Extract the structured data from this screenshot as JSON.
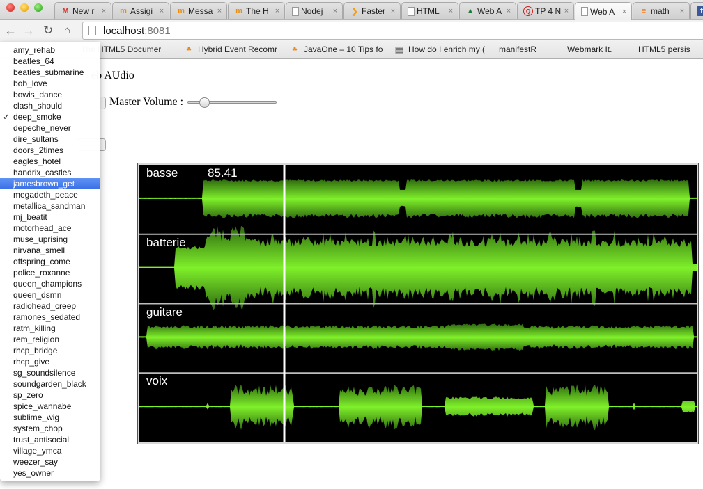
{
  "browser": {
    "tabs": [
      {
        "label": "New r",
        "icon": "gmail-icon",
        "active": false
      },
      {
        "label": "Assigi",
        "icon": "moodle-icon",
        "active": false
      },
      {
        "label": "Messa",
        "icon": "moodle-icon",
        "active": false
      },
      {
        "label": "The H",
        "icon": "moodle-icon",
        "active": false
      },
      {
        "label": "Nodej",
        "icon": "page-icon",
        "active": false
      },
      {
        "label": "Faster",
        "icon": "faster-icon",
        "active": false
      },
      {
        "label": "HTML",
        "icon": "page-icon",
        "active": false
      },
      {
        "label": "Web A",
        "icon": "tree-icon",
        "active": false
      },
      {
        "label": "TP 4 N",
        "icon": "tp-icon",
        "active": false
      },
      {
        "label": "Web A",
        "icon": "page-icon",
        "active": true
      },
      {
        "label": "math",
        "icon": "stackoverflow-icon",
        "active": false
      },
      {
        "label": "",
        "icon": "facebook-icon",
        "active": false
      }
    ],
    "tab_close_glyph": "×",
    "address": {
      "host": "localhost",
      "port": ":8081"
    },
    "bookmarks": [
      {
        "label": "The HTML5 Documer",
        "icon": "page-icon"
      },
      {
        "label": "Hybrid Event Recomr",
        "icon": "hybrid-icon"
      },
      {
        "label": "JavaOne – 10 Tips fo",
        "icon": "hybrid-icon"
      },
      {
        "label": "How do I enrich my (",
        "icon": "grid-icon"
      },
      {
        "label": "manifestR",
        "icon": "page-icon"
      },
      {
        "label": "Webmark It.",
        "icon": "page-icon"
      },
      {
        "label": "HTML5 persis",
        "icon": "page-icon"
      }
    ]
  },
  "page": {
    "title_visible": "eb AUdio",
    "master_volume_label": "Master Volume :",
    "master_volume_value": 0.15,
    "current_time": "85.41",
    "playhead_fraction": 0.26,
    "tracks": [
      {
        "name": "basse"
      },
      {
        "name": "batterie"
      },
      {
        "name": "guitare"
      },
      {
        "name": "voix"
      }
    ],
    "waveform_color": "#7ff02a"
  },
  "song_dropdown": {
    "checked": "deep_smoke",
    "highlighted": "jamesbrown_get",
    "check_glyph": "✓",
    "options": [
      "amy_rehab",
      "beatles_64",
      "beatles_submarine",
      "bob_love",
      "bowis_dance",
      "clash_should",
      "deep_smoke",
      "depeche_never",
      "dire_sultans",
      "doors_2times",
      "eagles_hotel",
      "handrix_castles",
      "jamesbrown_get",
      "megadeth_peace",
      "metallica_sandman",
      "mj_beatit",
      "motorhead_ace",
      "muse_uprising",
      "nirvana_smell",
      "offspring_come",
      "police_roxanne",
      "queen_champions",
      "queen_dsmn",
      "radiohead_creep",
      "ramones_sedated",
      "ratm_killing",
      "rem_religion",
      "rhcp_bridge",
      "rhcp_give",
      "sg_soundsilence",
      "soundgarden_black",
      "sp_zero",
      "spice_wannabe",
      "sublime_wig",
      "system_chop",
      "trust_antisocial",
      "village_ymca",
      "weezer_say",
      "yes_owner"
    ]
  }
}
